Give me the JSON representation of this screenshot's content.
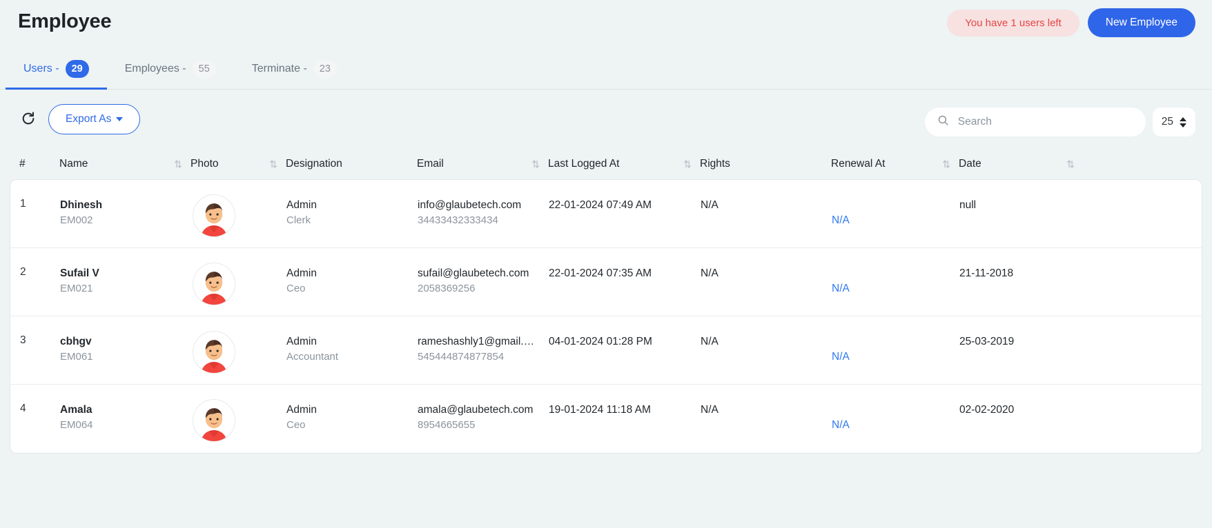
{
  "header": {
    "title": "Employee",
    "quota_badge": "You have 1 users left",
    "new_button": "New Employee",
    "accent_color": "#2f65e8",
    "badge_bg": "#f7e1e1",
    "badge_color": "#e74545"
  },
  "tabs": [
    {
      "label": "Users -",
      "count": "29",
      "active": true
    },
    {
      "label": "Employees -",
      "count": "55",
      "active": false
    },
    {
      "label": "Terminate -",
      "count": "23",
      "active": false
    }
  ],
  "toolbar": {
    "refresh_icon": "refresh-icon",
    "export_label": "Export As",
    "search_placeholder": "Search",
    "search_value": "",
    "page_size": "25"
  },
  "table": {
    "columns": [
      {
        "label": "#",
        "sortable": false
      },
      {
        "label": "Name",
        "sortable": true
      },
      {
        "label": "Photo",
        "sortable": true
      },
      {
        "label": "Designation",
        "sortable": false
      },
      {
        "label": "Email",
        "sortable": true
      },
      {
        "label": "Last Logged At",
        "sortable": true
      },
      {
        "label": "Rights",
        "sortable": false
      },
      {
        "label": "Renewal At",
        "sortable": true
      },
      {
        "label": "Date",
        "sortable": true
      }
    ],
    "rows": [
      {
        "index": "1",
        "name": "Dhinesh",
        "code": "EM002",
        "photo": "employee-avatar",
        "designation": "Admin",
        "role": "Clerk",
        "email": "info@glaubetech.com",
        "phone": "34433432333434",
        "last_logged_at": "22-01-2024 07:49 AM",
        "rights": "N/A",
        "renewal_at": "N/A",
        "date": "null"
      },
      {
        "index": "2",
        "name": "Sufail V",
        "code": "EM021",
        "photo": "employee-avatar",
        "designation": "Admin",
        "role": "Ceo",
        "email": "sufail@glaubetech.com",
        "phone": "2058369256",
        "last_logged_at": "22-01-2024 07:35 AM",
        "rights": "N/A",
        "renewal_at": "N/A",
        "date": "21-11-2018"
      },
      {
        "index": "3",
        "name": "cbhgv",
        "code": "EM061",
        "photo": "employee-avatar",
        "designation": "Admin",
        "role": "Accountant",
        "email": "rameshashly1@gmail.c…",
        "phone": "545444874877854",
        "last_logged_at": "04-01-2024 01:28 PM",
        "rights": "N/A",
        "renewal_at": "N/A",
        "date": "25-03-2019"
      },
      {
        "index": "4",
        "name": "Amala",
        "code": "EM064",
        "photo": "employee-avatar",
        "designation": "Admin",
        "role": "Ceo",
        "email": "amala@glaubetech.com",
        "phone": "8954665655",
        "last_logged_at": "19-01-2024 11:18 AM",
        "rights": "N/A",
        "renewal_at": "N/A",
        "date": "02-02-2020"
      }
    ]
  }
}
